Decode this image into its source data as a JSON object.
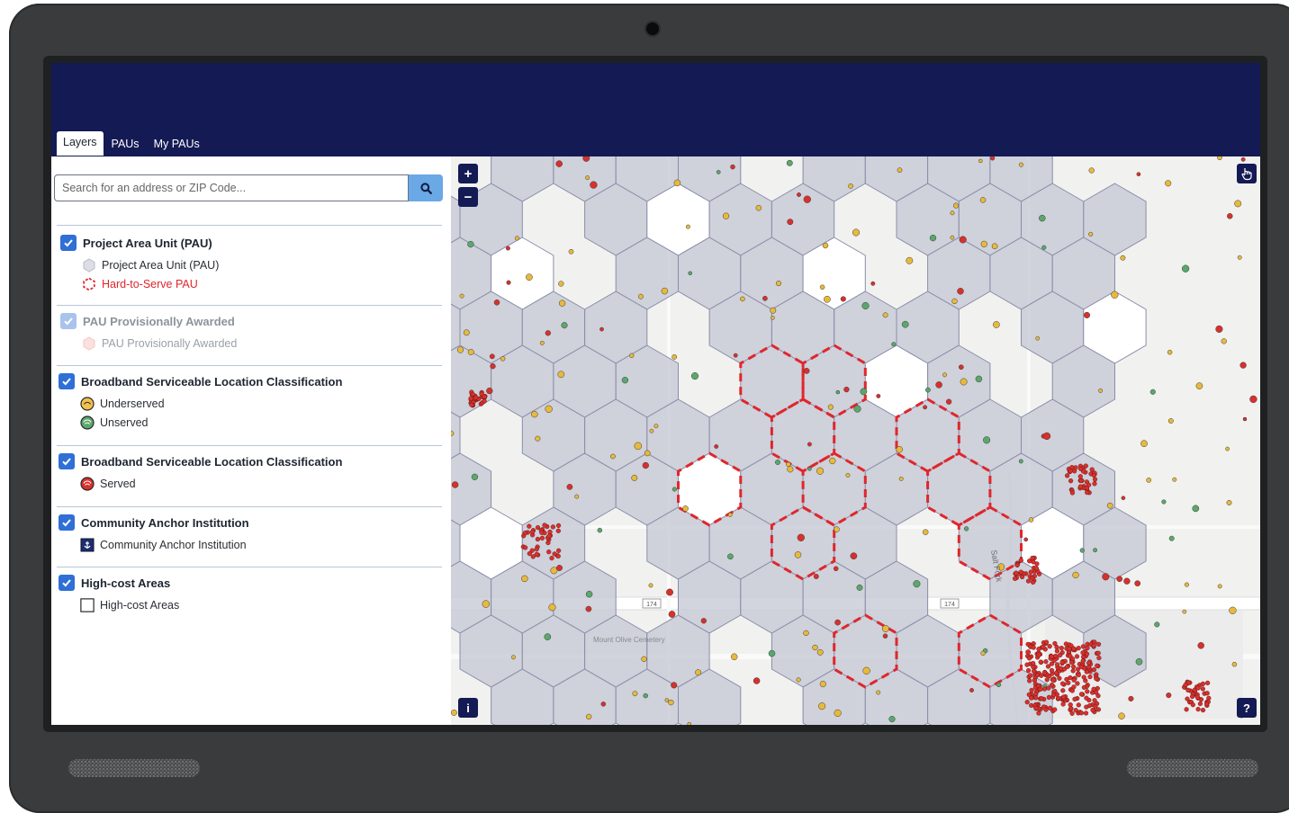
{
  "tabs": {
    "layers": "Layers",
    "paus": "PAUs",
    "my_paus": "My PAUs"
  },
  "search": {
    "placeholder": "Search for an address or ZIP Code..."
  },
  "layers": {
    "pau": {
      "title": "Project Area Unit (PAU)",
      "item1": "Project Area Unit (PAU)",
      "item2": "Hard-to-Serve PAU"
    },
    "awarded": {
      "title": "PAU Provisionally Awarded",
      "item1": "PAU Provisionally Awarded"
    },
    "bsl1": {
      "title": "Broadband Serviceable Location Classification",
      "item1": "Underserved",
      "item2": "Unserved"
    },
    "bsl2": {
      "title": "Broadband Serviceable Location Classification",
      "item1": "Served"
    },
    "cai": {
      "title": "Community Anchor Institution",
      "item1": "Community Anchor Institution"
    },
    "hca": {
      "title": "High-cost Areas",
      "item1": "High-cost Areas"
    }
  },
  "map": {
    "zoom_in": "+",
    "zoom_out": "−",
    "info": "i",
    "help": "?",
    "labels": {
      "road1": "174",
      "road2": "174",
      "creek": "Salt Fork",
      "cemetery": "Mount Olive Cemetery"
    }
  },
  "colors": {
    "header": "#141a54",
    "accent": "#2f6fd6",
    "hard_to_serve": "#e0262b",
    "hex_fill": "#c7c9d6"
  }
}
